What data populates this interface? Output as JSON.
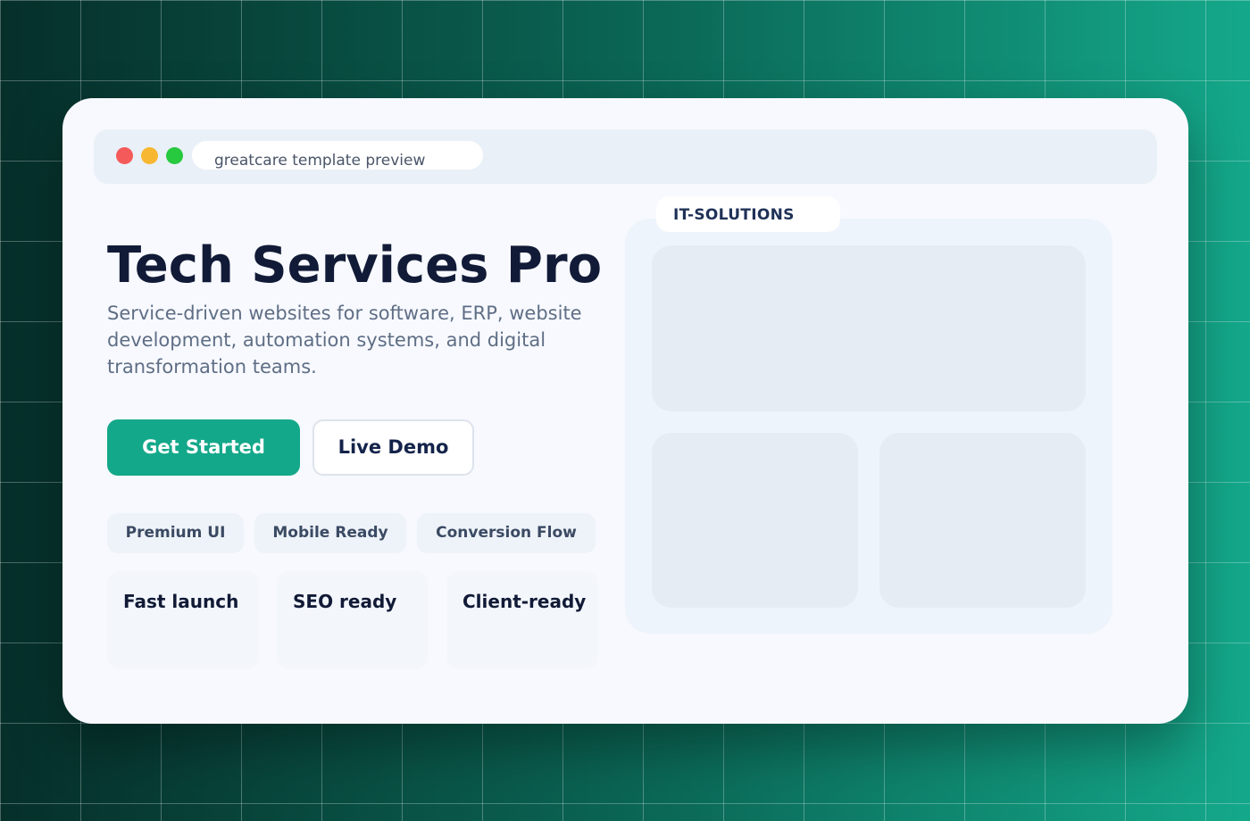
{
  "browser": {
    "url_text": "greatcare template preview"
  },
  "hero": {
    "title": "Tech Services Pro",
    "description": "Service-driven websites for software, ERP, website development, automation systems, and digital transformation teams.",
    "primary_button": "Get Started",
    "secondary_button": "Live Demo"
  },
  "tags": [
    "Premium UI",
    "Mobile Ready",
    "Conversion Flow"
  ],
  "features": [
    "Fast launch",
    "SEO ready",
    "Client-ready"
  ],
  "preview": {
    "badge": "IT-SOLUTIONS"
  },
  "colors": {
    "accent": "#14a88a",
    "title": "#111a36",
    "card_bg": "#f7f9fe"
  }
}
